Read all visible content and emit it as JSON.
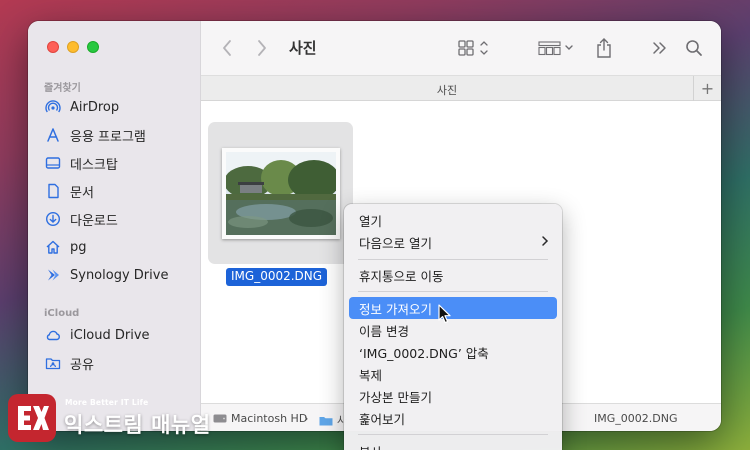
{
  "window": {
    "title": "사진",
    "tab_label": "사진",
    "tab_add": "+"
  },
  "sidebar": {
    "favorites_header": "즐겨찾기",
    "favorites": [
      {
        "label": "AirDrop",
        "icon": "airdrop-icon"
      },
      {
        "label": "응용 프로그램",
        "icon": "applications-icon"
      },
      {
        "label": "데스크탑",
        "icon": "desktop-icon"
      },
      {
        "label": "문서",
        "icon": "document-icon"
      },
      {
        "label": "다운로드",
        "icon": "download-icon"
      },
      {
        "label": "pg",
        "icon": "home-icon"
      },
      {
        "label": "Synology Drive",
        "icon": "synology-drive-icon"
      }
    ],
    "icloud_header": "iCloud",
    "icloud": [
      {
        "label": "iCloud Drive",
        "icon": "icloud-icon"
      },
      {
        "label": "공유",
        "icon": "shared-folder-icon"
      }
    ]
  },
  "file": {
    "name": "IMG_0002.DNG"
  },
  "pathbar": {
    "items": [
      "Macintosh HD",
      "사",
      "IMG_0002.DNG"
    ]
  },
  "context_menu": {
    "items": [
      {
        "label": "열기"
      },
      {
        "label": "다음으로 열기",
        "submenu": true
      },
      {
        "label": "휴지통으로 이동"
      },
      {
        "label": "정보 가져오기",
        "highlighted": true
      },
      {
        "label": "이름 변경"
      },
      {
        "label": "‘IMG_0002.DNG’ 압축"
      },
      {
        "label": "복제"
      },
      {
        "label": "가상본 만들기"
      },
      {
        "label": "훑어보기"
      },
      {
        "label": "복사"
      }
    ]
  },
  "watermark": {
    "tagline": "More Better IT Life",
    "name": "익스트림 매뉴얼"
  },
  "colors": {
    "selection": "#1d63d8",
    "menu_highlight": "#4b8ef7",
    "logo": "#c4262f",
    "sidebar_icon": "#2f6fe0"
  }
}
